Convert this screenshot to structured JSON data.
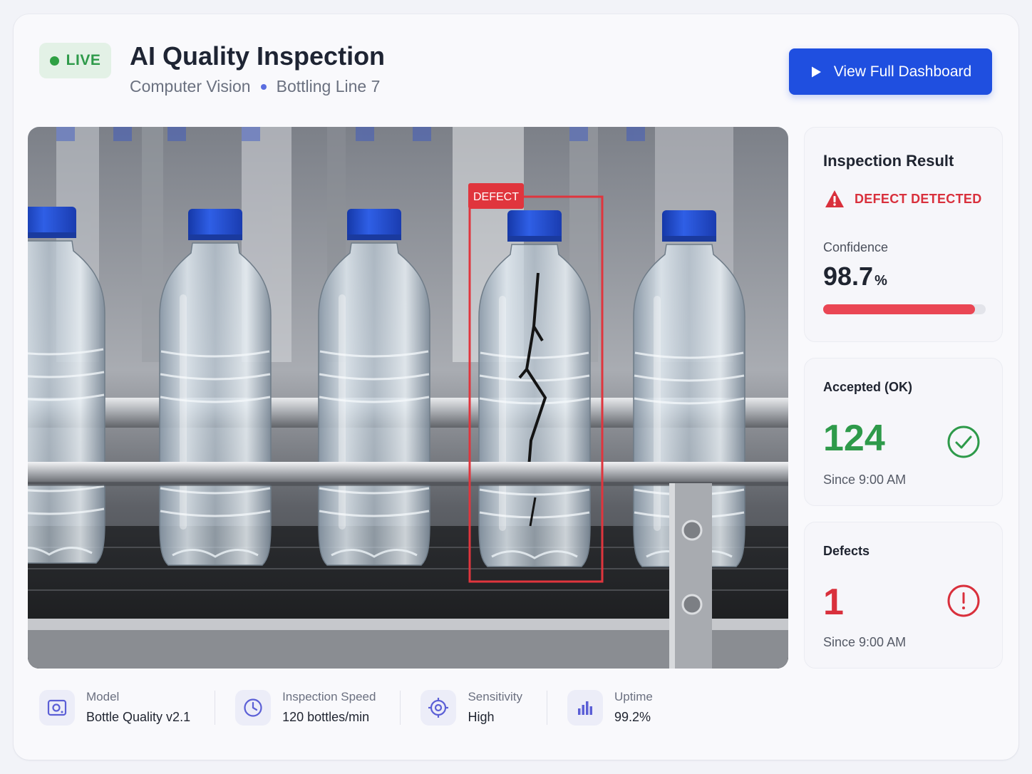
{
  "header": {
    "live_label": "LIVE",
    "title": "AI Quality Inspection",
    "subtitle_left": "Computer Vision",
    "subtitle_right": "Bottling Line 7",
    "cta_label": "View Full Dashboard"
  },
  "viewer": {
    "detection_label": "DEFECT"
  },
  "result": {
    "heading": "Inspection Result",
    "status": "DEFECT DETECTED",
    "confidence_label": "Confidence",
    "confidence_value": "98.7",
    "confidence_unit": "%",
    "confidence_fraction": 0.935
  },
  "accepted": {
    "heading": "Accepted (OK)",
    "count": "124",
    "since": "Since 9:00 AM"
  },
  "defects": {
    "heading": "Defects",
    "count": "1",
    "since": "Since 9:00 AM"
  },
  "footer": [
    {
      "label": "Model",
      "value": "Bottle Quality v2.1",
      "icon": "model-icon"
    },
    {
      "label": "Inspection Speed",
      "value": "120 bottles/min",
      "icon": "clock-icon"
    },
    {
      "label": "Sensitivity",
      "value": "High",
      "icon": "target-icon"
    },
    {
      "label": "Uptime",
      "value": "99.2%",
      "icon": "bar-chart-icon"
    }
  ],
  "colors": {
    "accent": "#1f4fe0",
    "ok": "#2e9a4a",
    "defect": "#d9303c",
    "live": "#2ea043"
  }
}
